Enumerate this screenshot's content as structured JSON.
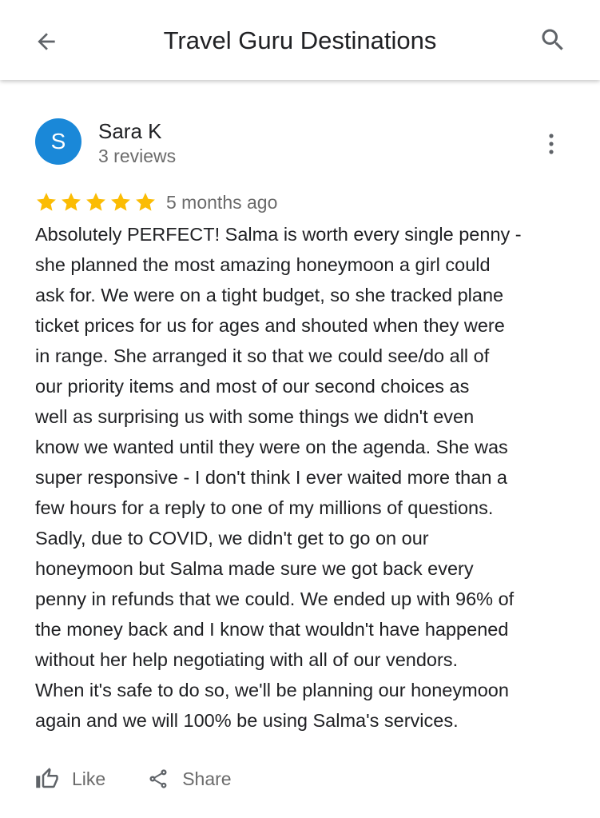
{
  "header": {
    "title": "Travel Guru Destinations",
    "back_icon": "arrow-back-icon",
    "search_icon": "search-icon"
  },
  "review": {
    "avatar_letter": "S",
    "avatar_color": "#1a88d8",
    "author": "Sara K",
    "reviews_count": "3 reviews",
    "rating": 5,
    "rating_max": 5,
    "star_color": "#fbbc04",
    "date": "5 months ago",
    "text": "Absolutely PERFECT! Salma is worth every single penny -\nshe planned the most amazing honeymoon a girl could\nask for. We were on a tight budget, so she tracked plane\nticket prices for us for ages and shouted when they were\nin range. She arranged it so that we could see/do all of\nour priority items and most of our second choices as\nwell as surprising us with some things we didn't even\nknow we wanted until they were on the agenda. She was\nsuper responsive - I don't think I ever waited more than a\nfew hours for a reply to one of my millions of questions.\nSadly, due to COVID, we didn't get to go on our\nhoneymoon but Salma made sure we got back every\npenny in refunds that we could. We ended up with 96% of\nthe money back and I know that wouldn't have happened\nwithout her help negotiating with all of our vendors.\nWhen it's safe to do so, we'll be planning our honeymoon\nagain and we will 100% be using Salma's services.",
    "more_icon": "more-vert-icon"
  },
  "actions": {
    "like_label": "Like",
    "share_label": "Share"
  }
}
